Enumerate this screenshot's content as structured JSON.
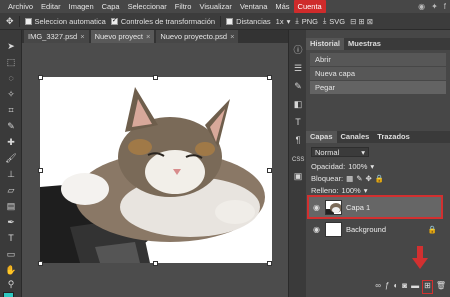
{
  "menu": {
    "items": [
      "Archivo",
      "Editar",
      "Imagen",
      "Capa",
      "Seleccionar",
      "Filtro",
      "Visualizar",
      "Ventana",
      "Más",
      "Cuenta"
    ],
    "highlighted": "Cuenta"
  },
  "options": {
    "auto_select": "Seleccion automatica",
    "transform_controls": "Controles de transformación",
    "distances": "Distancias",
    "zoom": "1x",
    "png": "PNG",
    "svg": "SVG"
  },
  "tabs": [
    {
      "label": "IMG_3327.psd",
      "close": "×"
    },
    {
      "label": "Nuevo proyect",
      "close": "×"
    },
    {
      "label": "Nuevo proyecto.psd",
      "close": "×"
    }
  ],
  "history": {
    "tab_history": "Historial",
    "tab_samples": "Muestras",
    "items": [
      "Abrir",
      "Nueva capa",
      "Pegar"
    ]
  },
  "layers": {
    "tab_layers": "Capas",
    "tab_channels": "Canales",
    "tab_paths": "Trazados",
    "blend_mode": "Normal",
    "opacity_label": "Opacidad:",
    "opacity_value": "100%",
    "lock_label": "Bloquear:",
    "fill_label": "Relleno:",
    "fill_value": "100%",
    "items": [
      {
        "name": "Capa 1",
        "selected": true
      },
      {
        "name": "Background",
        "selected": false
      }
    ]
  },
  "colors": {
    "accent_red": "#d23030",
    "foreground": "#2ec8c0",
    "background": "#f2e200"
  }
}
